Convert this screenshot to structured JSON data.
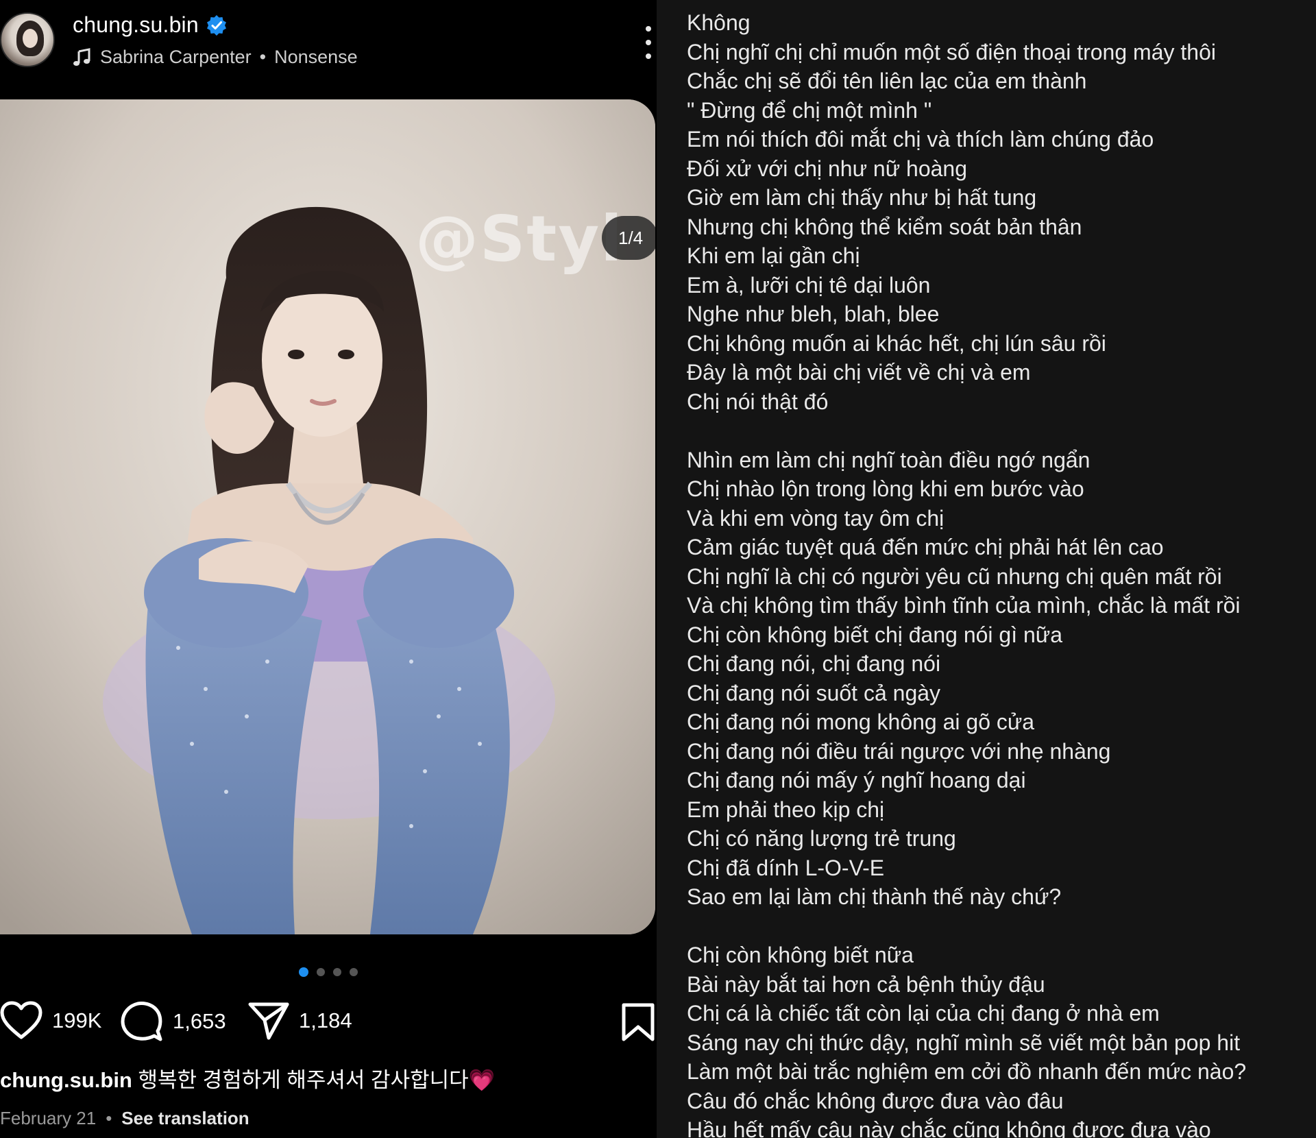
{
  "post": {
    "username": "chung.su.bin",
    "music": {
      "artist": "Sabrina Carpenter",
      "separator": "•",
      "song": "Nonsense"
    },
    "watermark": "@Styl",
    "slide_counter": "1/4",
    "carousel": {
      "total": 4,
      "active_index": 0
    },
    "stats": {
      "likes": "199K",
      "comments": "1,653",
      "shares": "1,184"
    },
    "caption": {
      "user": "chung.su.bin",
      "text": " 행복한 경험하게 해주셔서 감사합니다",
      "emoji": "💗"
    },
    "date": "February 21",
    "meta_separator": "•",
    "see_translation": "See translation"
  },
  "colors": {
    "background": "#000000",
    "lyrics_background": "#141414",
    "verified_blue": "#1e8ff0",
    "dot_active": "#1e8ff0",
    "dot_inactive": "#555555",
    "heart_pink": "#ff3b6b"
  },
  "icons": {
    "verified": "verified-badge-icon",
    "music": "music-note-icon",
    "more": "more-vertical-icon",
    "mute": "speaker-muted-icon",
    "like": "heart-icon",
    "comment": "comment-icon",
    "share": "send-icon",
    "save": "bookmark-icon"
  },
  "lyrics": [
    "Không",
    "Chị nghĩ chị chỉ muốn một số điện thoại trong máy thôi",
    "Chắc chị sẽ đổi tên liên lạc của em thành",
    "\" Đừng để chị một mình \"",
    "Em nói thích đôi mắt chị và thích làm chúng đảo",
    "Đối xử với chị như nữ hoàng",
    "Giờ em làm chị thấy như bị hất tung",
    "Nhưng chị không thể kiểm soát bản thân",
    "Khi em lại gần chị",
    "Em à, lưỡi chị tê dại luôn",
    "Nghe như bleh, blah, blee",
    "Chị không muốn ai khác hết, chị lún sâu rồi",
    "Đây là một bài chị viết về chị và em",
    "Chị nói thật đó",
    "",
    "Nhìn em làm chị nghĩ toàn điều ngớ ngẩn",
    "Chị nhào lộn trong lòng khi em bước vào",
    "Và khi em vòng tay ôm chị",
    "Cảm giác tuyệt quá đến mức chị phải hát lên cao",
    "Chị nghĩ là chị có người yêu cũ nhưng chị quên mất rồi",
    "Và chị không tìm thấy bình tĩnh của mình, chắc là mất rồi",
    "Chị còn không biết chị đang nói gì nữa",
    "Chị đang nói, chị đang nói",
    "Chị đang nói suốt cả ngày",
    "Chị đang nói mong không ai gõ cửa",
    "Chị đang nói điều trái ngược với nhẹ nhàng",
    "Chị đang nói mấy ý nghĩ hoang dại",
    "Em phải theo kịp chị",
    "Chị có năng lượng trẻ trung",
    "Chị đã dính L-O-V-E",
    "Sao em lại làm chị thành thế này chứ?",
    "",
    "Chị còn không biết nữa",
    "Bài này bắt tai hơn cả bệnh thủy đậu",
    "Chị cá là chiếc tất còn lại của chị đang ở nhà em",
    "Sáng nay chị thức dậy, nghĩ mình sẽ viết một bản pop hit",
    "Làm một bài trắc nghiệm em cởi đồ nhanh đến mức nào?",
    "Câu đó chắc không được đưa vào đâu",
    "Hầu hết mấy câu này chắc cũng không được đưa vào"
  ]
}
